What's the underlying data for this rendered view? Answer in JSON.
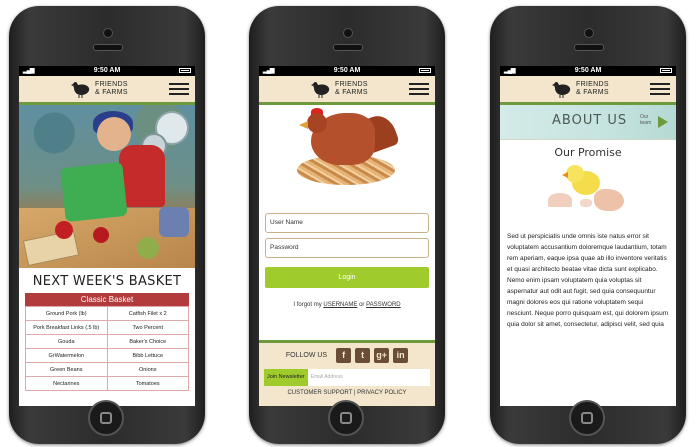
{
  "status": {
    "time": "9:50 AM"
  },
  "brand": {
    "line1": "FRIENDS",
    "line2": "& FARMS"
  },
  "screen1": {
    "heading": "NEXT WEEK'S BASKET",
    "basket_label": "Classic Basket",
    "rows": [
      [
        "Ground Pork (lb)",
        "Catfish Filet x 2"
      ],
      [
        "Pork Breakfast Links (.5 lb)",
        "Two Percent"
      ],
      [
        "Gouda",
        "Baker's Choice"
      ],
      [
        "GrWatermelon",
        "Bibb Lettuce"
      ],
      [
        "Green Beans",
        "Onions"
      ],
      [
        "Nectarines",
        "Tomatoes"
      ]
    ]
  },
  "screen2": {
    "username_placeholder": "User Name",
    "password_placeholder": "Password",
    "login_label": "Login",
    "forgot_prefix": "I forgot my",
    "forgot_username": "USERNAME",
    "forgot_or": "or",
    "forgot_password": "PASSWORD",
    "follow_label": "FOLLOW US",
    "social": [
      "f",
      "t",
      "g+",
      "in"
    ],
    "newsletter_label": "Join Newsletter",
    "email_placeholder": "Email Address",
    "customer_support": "CUSTOMER SUPPORT",
    "separator": "|",
    "privacy_policy": "PRIVACY POLICY"
  },
  "screen3": {
    "banner_title": "ABOUT US",
    "banner_link_line1": "Our",
    "banner_link_line2": "team",
    "promise_title": "Our Promise",
    "paragraph": "Sed ut perspiciatis unde omnis iste natus error sit voluptatem accusantium doloremque laudantium, totam rem aperiam, eaque ipsa quae ab illo inventore veritatis et quasi architecto beatae vitae dicta sunt explicabo. Nemo enim ipsam voluptatem quia voluptas sit aspernatur aut odit aut fugit, sed quia consequuntur magni dolores eos qui ratione voluptatem sequi nesciunt. Neque porro quisquam est, qui dolorem ipsum quia dolor sit amet, consectetur, adipisci velit, sed quia"
  },
  "colors": {
    "header_bg": "#f3e6cc",
    "accent_green": "#9fcb2c",
    "basket_red": "#b23b3b"
  }
}
